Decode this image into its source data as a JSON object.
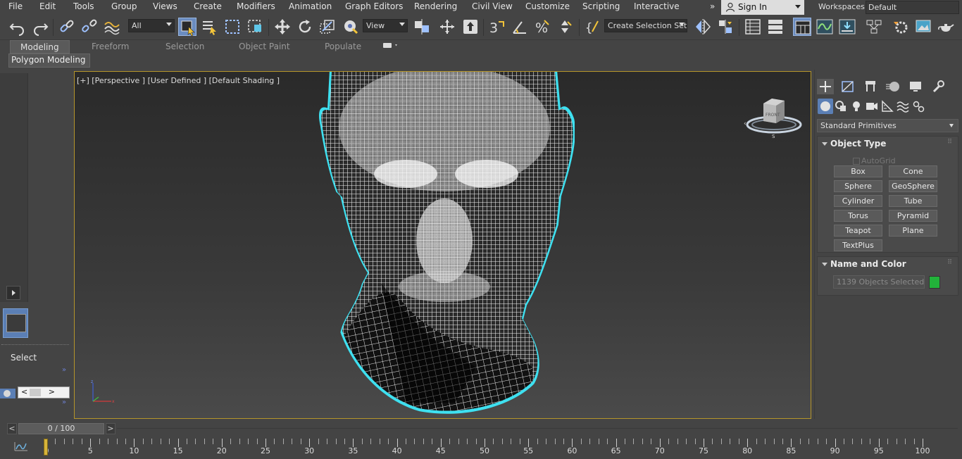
{
  "menu": {
    "items": [
      "File",
      "Edit",
      "Tools",
      "Group",
      "Views",
      "Create",
      "Modifiers",
      "Animation",
      "Graph Editors",
      "Rendering",
      "Civil View",
      "Customize",
      "Scripting",
      "Interactive"
    ],
    "overflow": "»",
    "sign_in": "Sign In",
    "workspaces_label": "Workspaces:",
    "workspace_value": "Default"
  },
  "toolbar": {
    "selection_filter": "All",
    "ref_coord": "View",
    "named_selection": "Create Selection Set"
  },
  "ribbon": {
    "tabs": [
      "Modeling",
      "Freeform",
      "Selection",
      "Object Paint",
      "Populate"
    ],
    "active_tab": "Modeling",
    "sub_panel": "Polygon Modeling"
  },
  "left_panel": {
    "select_label": "Select",
    "scroll_left": "<",
    "scroll_right": ">"
  },
  "viewport": {
    "label": "[+] [Perspective ] [User Defined ] [Default Shading ]",
    "viewcube_face": "FRONT"
  },
  "command_panel": {
    "category": "Standard Primitives",
    "object_type": {
      "title": "Object Type",
      "autogrid": "AutoGrid",
      "buttons": [
        "Box",
        "Cone",
        "Sphere",
        "GeoSphere",
        "Cylinder",
        "Tube",
        "Torus",
        "Pyramid",
        "Teapot",
        "Plane",
        "TextPlus"
      ]
    },
    "name_and_color": {
      "title": "Name and Color",
      "name_value": "1139 Objects Selected",
      "color": "#22b33a"
    }
  },
  "time_slider": {
    "position": "0 / 100",
    "prev": "<",
    "next": ">"
  },
  "trackbar": {
    "labels": [
      "0",
      "5",
      "10",
      "15",
      "20",
      "25",
      "30",
      "35",
      "40",
      "45",
      "50",
      "55",
      "60",
      "65",
      "70",
      "75",
      "80",
      "85",
      "90",
      "95",
      "100"
    ]
  },
  "colors": {
    "accent": "#6a8cc0",
    "viewport_border": "#b5952a",
    "selection_outline": "#3ee0f0"
  }
}
